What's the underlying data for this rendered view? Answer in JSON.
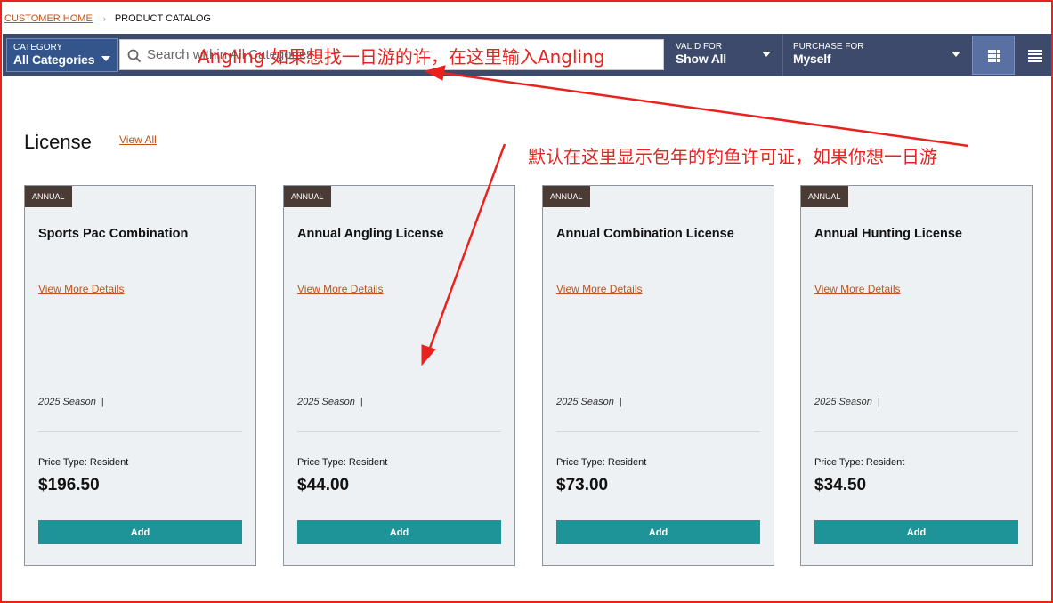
{
  "breadcrumb": {
    "home": "Customer Home",
    "separator": "›",
    "current": "Product Catalog"
  },
  "toolbar": {
    "category_label": "Category",
    "category_value": "All Categories",
    "search_placeholder": "Search within All Categories",
    "valid_for_label": "Valid For",
    "valid_for_value": "Show All",
    "purchase_for_label": "Purchase For",
    "purchase_for_value": "Myself"
  },
  "section": {
    "title": "License",
    "view_all": "View All"
  },
  "cards": [
    {
      "badge": "Annual",
      "title": "Sports Pac Combination",
      "details": "View More Details",
      "season": "2025 Season",
      "season_sep": "|",
      "price_type": "Price Type: Resident",
      "price": "$196.50",
      "add": "Add"
    },
    {
      "badge": "Annual",
      "title": "Annual Angling License",
      "details": "View More Details",
      "season": "2025 Season",
      "season_sep": "|",
      "price_type": "Price Type: Resident",
      "price": "$44.00",
      "add": "Add"
    },
    {
      "badge": "Annual",
      "title": "Annual Combination License",
      "details": "View More Details",
      "season": "2025 Season",
      "season_sep": "|",
      "price_type": "Price Type: Resident",
      "price": "$73.00",
      "add": "Add"
    },
    {
      "badge": "Annual",
      "title": "Annual Hunting License",
      "details": "View More Details",
      "season": "2025 Season",
      "season_sep": "|",
      "price_type": "Price Type: Resident",
      "price": "$34.50",
      "add": "Add"
    }
  ],
  "annotations": {
    "search_note": "Angling  如果想找一日游的许，在这里输入Angling",
    "default_note": "默认在这里显示包年的钓鱼许可证，如果你想一日游",
    "color": "#e8231f"
  },
  "colors": {
    "toolbar": "#3d4a6b",
    "category_box": "#34558b",
    "link": "#c0531c",
    "add_button": "#1e9398",
    "badge": "#4a3b34",
    "card_bg": "#eef1f4"
  },
  "icons": {
    "search": "search-icon",
    "caret": "chevron-down-icon",
    "grid_view": "grid-view-icon",
    "list_view": "list-view-icon"
  }
}
